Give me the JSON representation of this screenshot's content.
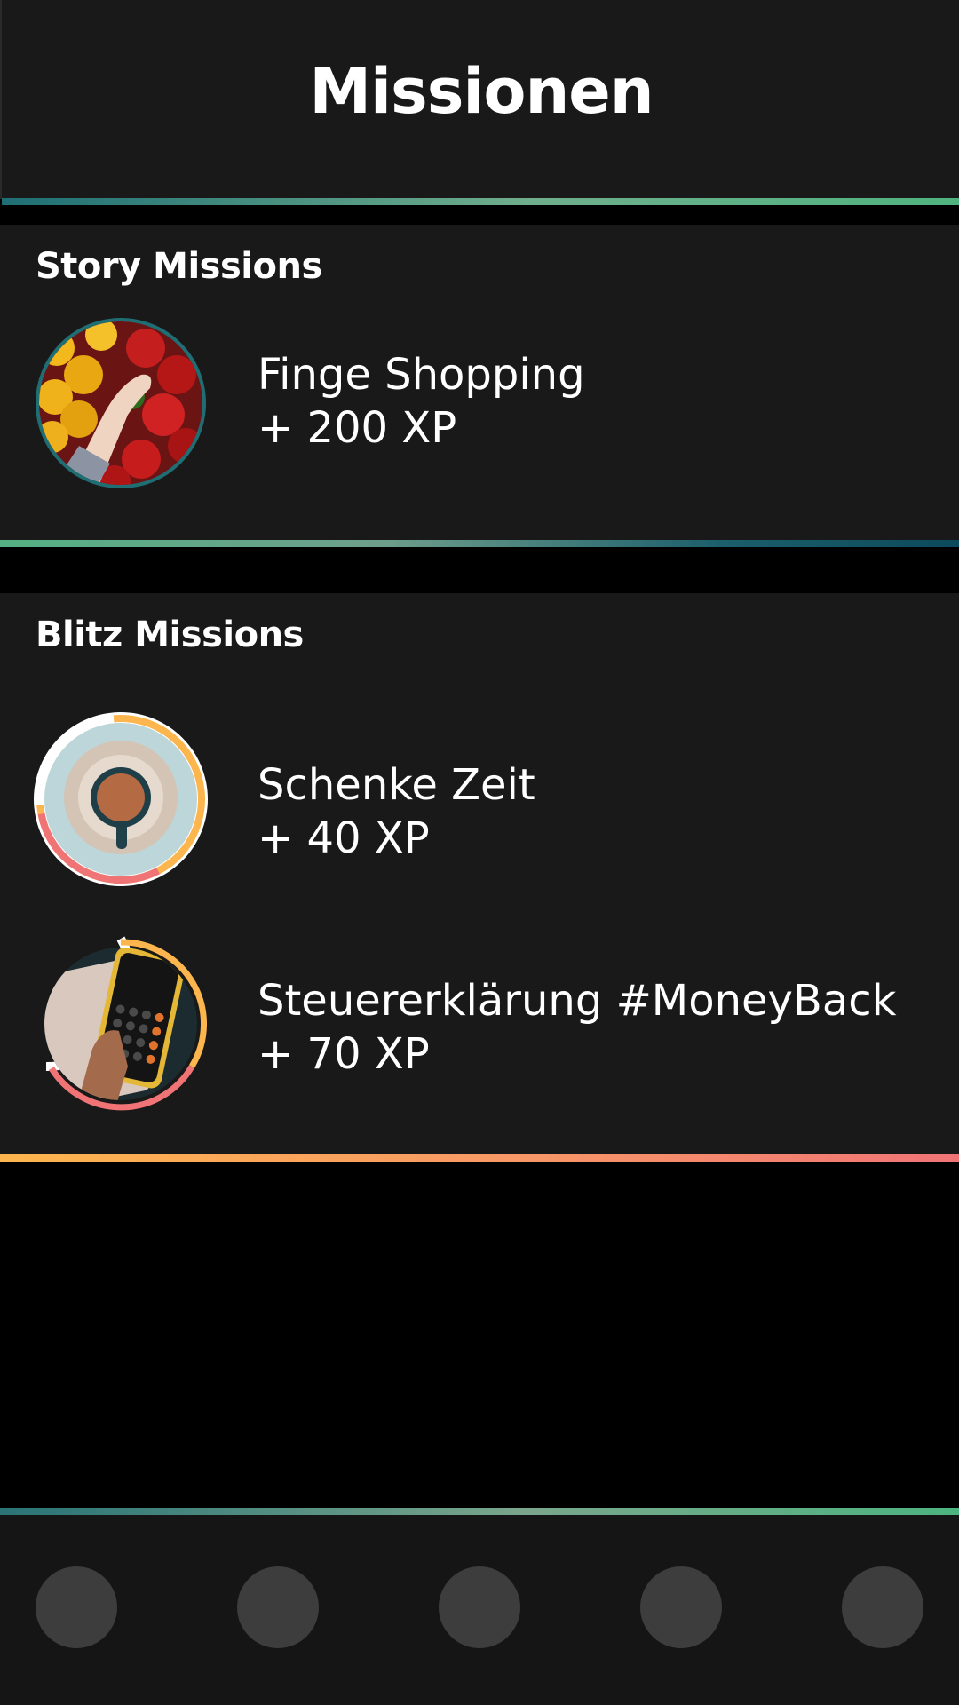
{
  "header": {
    "title": "Missionen"
  },
  "story": {
    "title": "Story Missions",
    "missions": [
      {
        "name": "Finge Shopping",
        "xp": "+ 200 XP",
        "image": "peppers-photo",
        "ring_color": "#1f6e74"
      }
    ]
  },
  "blitz": {
    "title": "Blitz Missions",
    "missions": [
      {
        "name": "Schenke Zeit",
        "xp": "+ 40 XP",
        "image": "coffee-cup-photo",
        "progress": 0.75
      },
      {
        "name": "Steuererklärung #MoneyBack",
        "xp": "+ 70 XP",
        "image": "calculator-phone-photo",
        "progress": 0.6
      }
    ]
  },
  "colors": {
    "background": "#191919",
    "ring_orange": "#fdb54d",
    "ring_pink": "#f07476",
    "teal": "#1f6e74",
    "green": "#4fb37f"
  },
  "nav": {
    "items": [
      "nav-button-1",
      "nav-button-2",
      "nav-button-3",
      "nav-button-4",
      "nav-button-5"
    ]
  }
}
